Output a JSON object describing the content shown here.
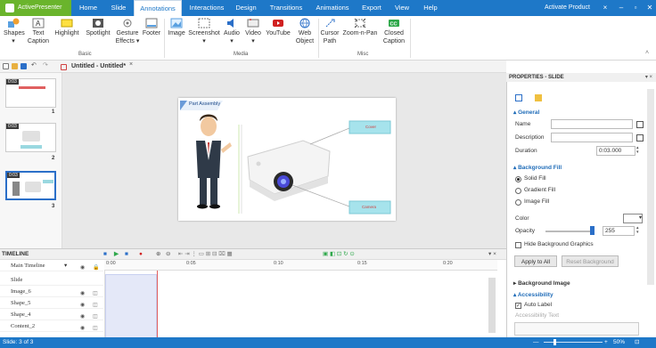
{
  "app": {
    "name": "ActivePresenter",
    "activate": "Activate Product"
  },
  "menu_tabs": [
    "Home",
    "Slide",
    "Annotations",
    "Interactions",
    "Design",
    "Transitions",
    "Animations",
    "Export",
    "View",
    "Help"
  ],
  "active_tab": "Annotations",
  "ribbon": {
    "basic": [
      "Shapes",
      "Text Caption",
      "Highlight",
      "Spotlight",
      "Gesture Effects",
      "Footer"
    ],
    "media": [
      "Image",
      "Screenshot",
      "Audio",
      "Video",
      "YouTube",
      "Web Object"
    ],
    "misc": [
      "Cursor Path",
      "Zoom-n-Pan",
      "Closed Caption"
    ],
    "group_labels": [
      "Basic",
      "Media",
      "Misc"
    ]
  },
  "document": {
    "title": "Untitled - Untitled*"
  },
  "slides": [
    {
      "num": "1",
      "duration": "0:03"
    },
    {
      "num": "2",
      "duration": "0:03"
    },
    {
      "num": "3",
      "duration": "0:03"
    }
  ],
  "slide_content": {
    "title": "Part Assembly",
    "label_top": "Cover",
    "label_bottom": "Camera"
  },
  "timeline": {
    "header": "TIMELINE",
    "main_label": "Main Timeline",
    "rows": [
      "Slide",
      "Image_6",
      "Shape_5",
      "Shape_4",
      "Content_2"
    ],
    "ticks": [
      "0:00",
      "0:05",
      "0:10",
      "0:15",
      "0:20"
    ]
  },
  "properties": {
    "header": "PROPERTIES - SLIDE",
    "general": "General",
    "name_label": "Name",
    "description_label": "Description",
    "duration_label": "Duration",
    "duration_value": "0:03.000",
    "background_fill": "Background Fill",
    "fill_options": [
      "Solid Fill",
      "Gradient Fill",
      "Image Fill"
    ],
    "selected_fill": "Solid Fill",
    "color_label": "Color",
    "opacity_label": "Opacity",
    "opacity_value": "255",
    "hide_bg": "Hide Background Graphics",
    "apply_all": "Apply to All",
    "reset_bg": "Reset Background",
    "background_image": "Background Image",
    "accessibility": "Accessibility",
    "auto_label": "Auto Label",
    "accessibility_text": "Accessibility Text"
  },
  "status": {
    "left": "Slide: 3 of 3",
    "zoom": "50%"
  }
}
